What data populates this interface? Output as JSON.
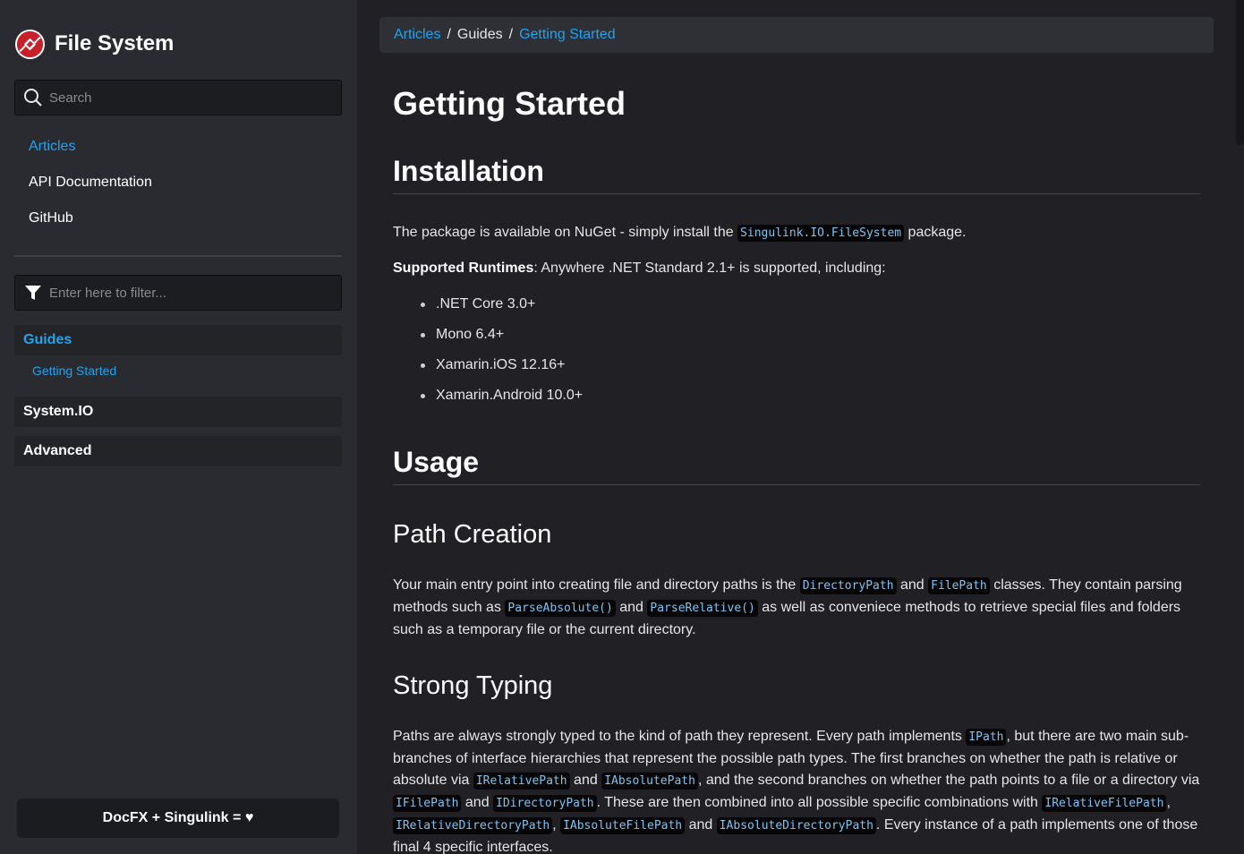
{
  "brand": {
    "title": "File System",
    "logo_icon": "singulink-plug-logo",
    "logo_color": "#c8202b"
  },
  "search": {
    "placeholder": "Search",
    "value": ""
  },
  "topnav": [
    {
      "label": "Articles",
      "active": true
    },
    {
      "label": "API Documentation",
      "active": false
    },
    {
      "label": "GitHub",
      "active": false
    }
  ],
  "filter": {
    "placeholder": "Enter here to filter...",
    "value": ""
  },
  "toc": {
    "sections": [
      {
        "label": "Guides",
        "active": true,
        "children": [
          {
            "label": "Getting Started",
            "active": true
          }
        ]
      },
      {
        "label": "System.IO",
        "active": false
      },
      {
        "label": "Advanced",
        "active": false
      }
    ]
  },
  "footer": {
    "label": "DocFX + Singulink = ♥"
  },
  "breadcrumb": [
    {
      "label": "Articles",
      "link": true
    },
    {
      "label": "Guides",
      "link": false
    },
    {
      "label": "Getting Started",
      "link": true
    }
  ],
  "breadcrumb_separator": "/",
  "article": {
    "title": "Getting Started",
    "installation": {
      "heading": "Installation",
      "p1_before": "The package is available on NuGet - simply install the ",
      "p1_code": "Singulink.IO.FileSystem",
      "p1_after": " package.",
      "p2_bold": "Supported Runtimes",
      "p2_text": ": Anywhere .NET Standard 2.1+ is supported, including:",
      "runtimes": [
        ".NET Core 3.0+",
        "Mono 6.4+",
        "Xamarin.iOS 12.16+",
        "Xamarin.Android 10.0+"
      ]
    },
    "usage": {
      "heading": "Usage"
    },
    "path_creation": {
      "heading": "Path Creation",
      "t1": "Your main entry point into creating file and directory paths is the ",
      "c1": "DirectoryPath",
      "t2": " and ",
      "c2": "FilePath",
      "t3": " classes. They contain parsing methods such as ",
      "c3": "ParseAbsolute()",
      "t4": " and ",
      "c4": "ParseRelative()",
      "t5": " as well as conveniece methods to retrieve special files and folders such as a temporary file or the current directory."
    },
    "strong_typing": {
      "heading": "Strong Typing",
      "t1": "Paths are always strongly typed to the kind of path they represent. Every path implements ",
      "c1": "IPath",
      "t2": ", but there are two main sub-branches of interface hierarchies that represent the possible path types. The first branches on whether the path is relative or absolute via ",
      "c2": "IRelativePath",
      "t3": " and ",
      "c3": "IAbsolutePath",
      "t4": ", and the second branches on whether the path points to a file or a directory via ",
      "c4": "IFilePath",
      "t5": " and ",
      "c5": "IDirectoryPath",
      "t6": ". These are then combined into all possible specific combinations with ",
      "c6": "IRelativeFilePath",
      "t7": ", ",
      "c7": "IRelativeDirectoryPath",
      "t8": ", ",
      "c8": "IAbsoluteFilePath",
      "t9": " and ",
      "c9": "IAbsoluteDirectoryPath",
      "t10": ". Every instance of a path implements one of those final 4 specific interfaces."
    }
  },
  "colors": {
    "accent": "#1ea3ef",
    "code_text": "#7cc4f4",
    "sidebar_bg": "#2a2b30",
    "main_bg": "#202025"
  }
}
